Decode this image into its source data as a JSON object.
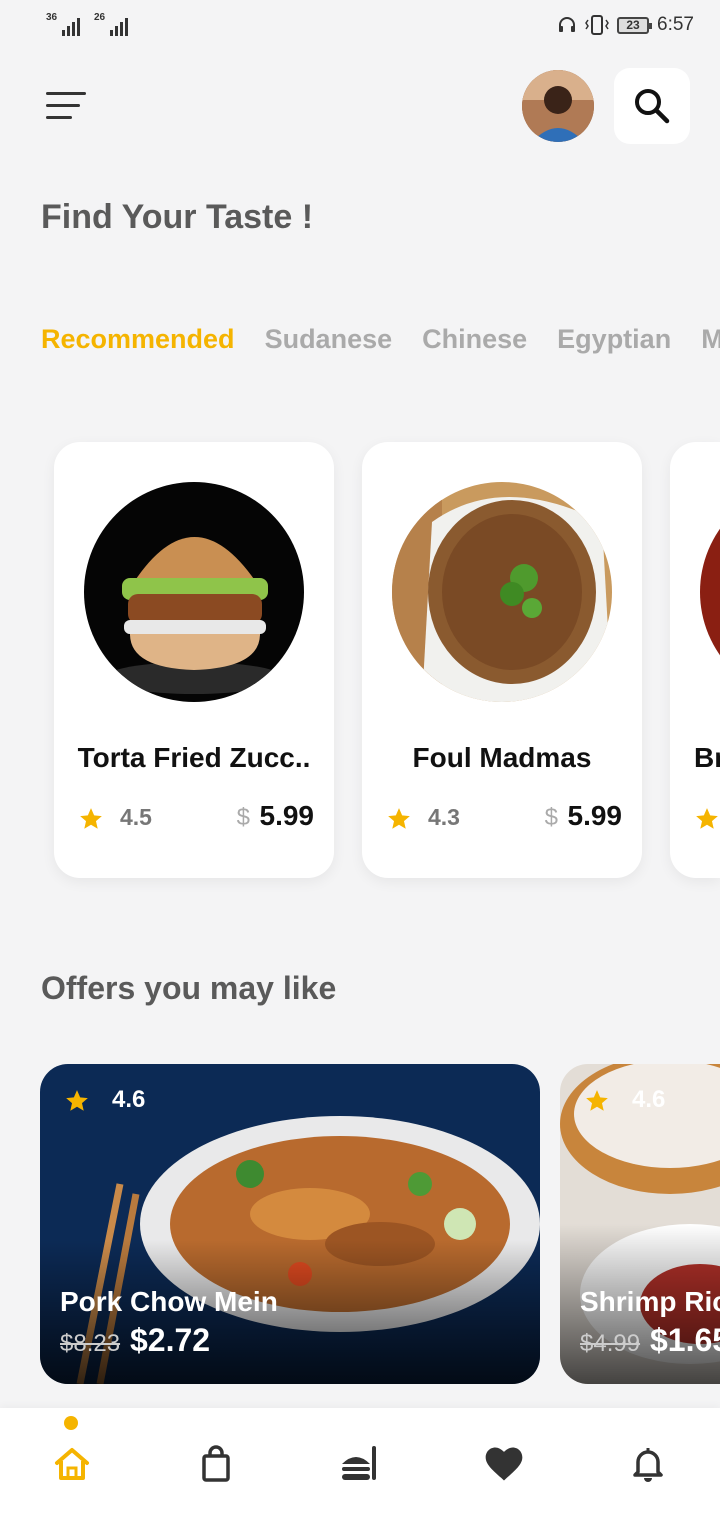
{
  "status_bar": {
    "sim1_label": "36",
    "sim2_label": "26",
    "battery": "23",
    "time": "6:57",
    "icons": [
      "signal-icon",
      "signal-icon",
      "headset-icon",
      "vibrate-icon",
      "battery-icon"
    ]
  },
  "header": {
    "menu_icon": "menu-icon",
    "avatar": "user-avatar",
    "search_icon": "search-icon"
  },
  "page_title": "Find Your Taste !",
  "tabs": [
    {
      "label": "Recommended",
      "active": true
    },
    {
      "label": "Sudanese",
      "active": false
    },
    {
      "label": "Chinese",
      "active": false
    },
    {
      "label": "Egyptian",
      "active": false
    },
    {
      "label": "Me",
      "active": false
    }
  ],
  "food_cards": [
    {
      "name": "Torta Fried Zucc..",
      "rating": "4.5",
      "currency": "$",
      "price": "5.99"
    },
    {
      "name": "Foul Madmas",
      "rating": "4.3",
      "currency": "$",
      "price": "5.99"
    },
    {
      "name": "Br",
      "rating": "",
      "currency": "",
      "price": ""
    }
  ],
  "offers_title": "Offers you may like",
  "offers": [
    {
      "rating": "4.6",
      "name": "Pork Chow Mein",
      "old_price": "$8.23",
      "new_price": "$2.72"
    },
    {
      "rating": "4.6",
      "name": "Shrimp Ric",
      "old_price": "$4.99",
      "new_price": "$1.65"
    }
  ],
  "bottom_nav": [
    {
      "icon": "home-icon",
      "active": true
    },
    {
      "icon": "shopping-bag-icon",
      "active": false
    },
    {
      "icon": "food-icon",
      "active": false
    },
    {
      "icon": "heart-icon",
      "active": false
    },
    {
      "icon": "bell-icon",
      "active": false
    }
  ],
  "colors": {
    "accent": "#f5b400",
    "background": "#f4f4f5",
    "text_muted": "#5a5a5a"
  }
}
